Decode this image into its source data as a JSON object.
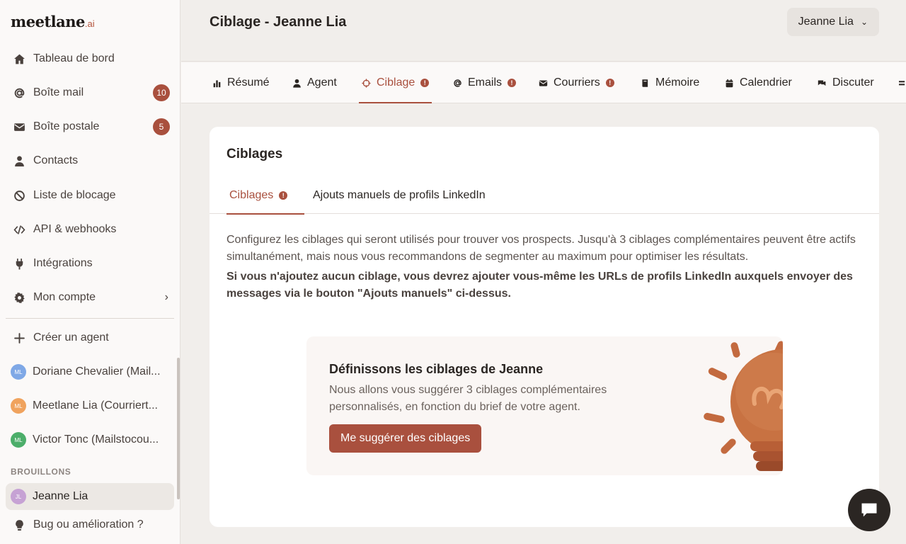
{
  "app": {
    "logo_text": "meetlane",
    "logo_suffix": ".ai"
  },
  "sidebar": {
    "items": [
      {
        "label": "Tableau de bord",
        "icon": "home-icon"
      },
      {
        "label": "Boîte mail",
        "icon": "at-icon",
        "badge": "10"
      },
      {
        "label": "Boîte postale",
        "icon": "envelope-icon",
        "badge": "5"
      },
      {
        "label": "Contacts",
        "icon": "user-icon"
      },
      {
        "label": "Liste de blocage",
        "icon": "ban-icon"
      },
      {
        "label": "API & webhooks",
        "icon": "code-icon"
      },
      {
        "label": "Intégrations",
        "icon": "plug-icon"
      },
      {
        "label": "Mon compte",
        "icon": "gear-icon"
      }
    ],
    "create_agent": "Créer un agent",
    "agents": [
      {
        "label": "Doriane Chevalier (Mail...",
        "initials": "ML",
        "color": "#7fa8e6"
      },
      {
        "label": "Meetlane Lia (Courriert...",
        "initials": "ML",
        "color": "#f0a35e"
      },
      {
        "label": "Victor Tonc (Mailstocou...",
        "initials": "ML",
        "color": "#4cae6a"
      }
    ],
    "drafts_title": "BROUILLONS",
    "drafts": [
      {
        "label": "Jeanne Lia",
        "initials": "JL",
        "color": "#c6a2d4"
      }
    ],
    "feedback": "Bug ou amélioration ?"
  },
  "header": {
    "title": "Ciblage - Jeanne Lia",
    "user": "Jeanne Lia"
  },
  "tabs": [
    {
      "label": "Résumé",
      "icon": "bar-chart-icon"
    },
    {
      "label": "Agent",
      "icon": "user-icon"
    },
    {
      "label": "Ciblage",
      "icon": "crosshair-icon",
      "warn": "!"
    },
    {
      "label": "Emails",
      "icon": "at-icon",
      "warn": "!"
    },
    {
      "label": "Courriers",
      "icon": "envelope-icon",
      "warn": "!"
    },
    {
      "label": "Mémoire",
      "icon": "book-icon"
    },
    {
      "label": "Calendrier",
      "icon": "calendar-icon"
    },
    {
      "label": "Discuter",
      "icon": "chat-icon"
    }
  ],
  "card": {
    "title": "Ciblages",
    "subtabs": [
      {
        "label": "Ciblages",
        "warn": "!"
      },
      {
        "label": "Ajouts manuels de profils LinkedIn"
      }
    ],
    "description": "Configurez les ciblages qui seront utilisés pour trouver vos prospects. Jusqu'à 3 ciblages complémentaires peuvent être actifs simultanément, mais nous vous recommandons de segmenter au maximum pour optimiser les résultats.",
    "description_bold": "Si vous n'ajoutez aucun ciblage, vous devrez ajouter vous-même les URLs de profils LinkedIn auxquels envoyer des messages via le bouton \"Ajouts manuels\" ci-dessus."
  },
  "suggestion": {
    "title": "Définissons les ciblages de Jeanne",
    "text": "Nous allons vous suggérer 3 ciblages complémentaires personnalisés, en fonction du brief de votre agent.",
    "button": "Me suggérer des ciblages",
    "illustration": "lightbulb-icon"
  },
  "colors": {
    "accent": "#a9503e",
    "background": "#f1eeeb",
    "sidebar": "#fbf9f8"
  }
}
